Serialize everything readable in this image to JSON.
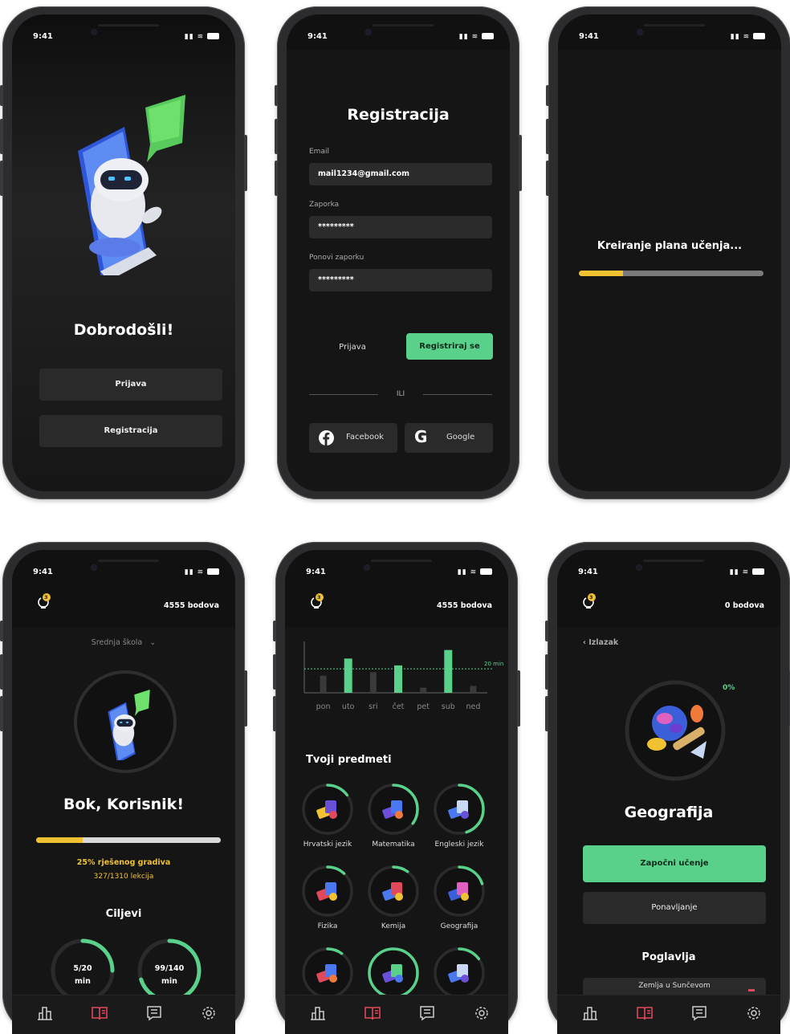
{
  "status": {
    "time": "9:41"
  },
  "colors": {
    "accent_green": "#5ad18b",
    "accent_yellow": "#f0c231",
    "accent_red": "#e0485b",
    "background": "#151515"
  },
  "icons": {
    "signal": "signal-icon",
    "wifi": "wifi-icon",
    "battery": "battery-icon",
    "robot": "robot-phone-illustration",
    "bulb": "lightbulb-icon",
    "tab_stats": "bar-chart-icon",
    "tab_learn": "open-book-icon",
    "tab_notes": "notes-icon",
    "tab_settings": "gear-icon",
    "facebook": "facebook-icon",
    "google": "google-icon",
    "chevron": "chevron-down-icon"
  },
  "screen1": {
    "title": "Dobrodošli!",
    "login_button": "Prijava",
    "register_button": "Registracija"
  },
  "screen2": {
    "title": "Registracija",
    "email_label": "Email",
    "email_value": "mail1234@gmail.com",
    "password_label": "Zaporka",
    "password_value": "*********",
    "repeat_label": "Ponovi zaporku",
    "repeat_value": "*********",
    "login_link": "Prijava",
    "register_button": "Registriraj se",
    "divider": "ILI",
    "facebook_button": "Facebook",
    "google_button": "Google"
  },
  "screen3": {
    "title": "Kreiranje plana učenja...",
    "progress": 0.24
  },
  "screen4": {
    "badge": "3",
    "points": "4555 bodova",
    "school": "Srednja škola",
    "greeting": "Bok, Korisnik!",
    "progress": 0.25,
    "progress_text": "25% rješenog gradiva",
    "lessons_text": "327/1310 lekcija",
    "goals_title": "Ciljevi",
    "goals": [
      {
        "value": "5/20",
        "unit": "min",
        "fraction": 0.25
      },
      {
        "value": "99/140",
        "unit": "min",
        "fraction": 0.7
      }
    ]
  },
  "screen5": {
    "badge": "3",
    "points": "4555 bodova",
    "subjects_title": "Tvoji predmeti",
    "subjects": [
      {
        "name": "Hrvatski jezik",
        "fraction": 0.15
      },
      {
        "name": "Matematika",
        "fraction": 0.35
      },
      {
        "name": "Engleski jezik",
        "fraction": 0.45
      },
      {
        "name": "Fizika",
        "fraction": 0.12
      },
      {
        "name": "Kemija",
        "fraction": 0.1
      },
      {
        "name": "Geografija",
        "fraction": 0.2
      },
      {
        "name": "",
        "fraction": 0.1
      },
      {
        "name": "",
        "fraction": 1.0
      },
      {
        "name": "",
        "fraction": 0.15
      }
    ]
  },
  "chart_data": {
    "type": "bar",
    "categories": [
      "pon",
      "uto",
      "sri",
      "čet",
      "pet",
      "sub",
      "ned"
    ],
    "series": [
      {
        "values": [
          10,
          20,
          12,
          16,
          3,
          25,
          4
        ]
      }
    ],
    "target_line": 14,
    "target_label": "20 min",
    "ylim": [
      0,
      30
    ],
    "highlight": [
      false,
      true,
      false,
      true,
      false,
      true,
      false
    ],
    "xlabel": "",
    "ylabel": ""
  },
  "screen6": {
    "badge": "3",
    "points": "0 bodova",
    "back": "Izlazak",
    "percent": "0%",
    "subject": "Geografija",
    "start_button": "Započni učenje",
    "repeat_button": "Ponavljanje",
    "chapters_title": "Poglavlja",
    "chapter_1": "Zemlja u Sunčevom"
  }
}
